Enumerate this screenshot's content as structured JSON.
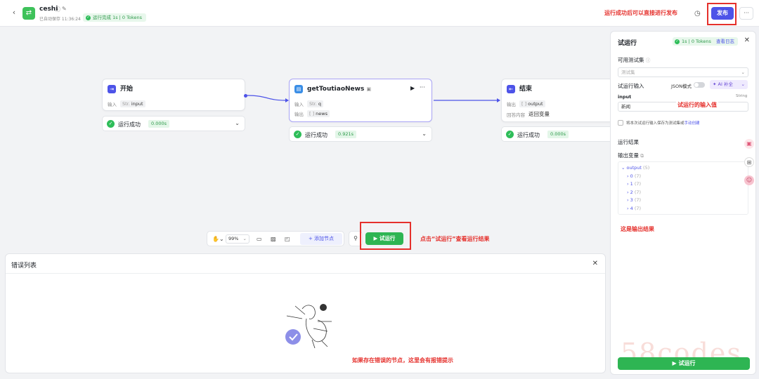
{
  "header": {
    "back": "‹",
    "app_icon": "workflow-icon",
    "app_name": "ceshi",
    "autosave": "已自动保存 11:36:24",
    "run_status": "运行完成 1s | 0 Tokens",
    "publish_note": "运行成功后可以直接进行发布",
    "publish_label": "发布",
    "more_label": "···"
  },
  "nodes": {
    "start": {
      "title": "开始",
      "input_label": "输入",
      "input_type": "Str.",
      "input_var": "input",
      "status": "运行成功",
      "time": "0.000s"
    },
    "plugin": {
      "title": "getToutiaoNews",
      "input_label": "输入",
      "input_type": "Str.",
      "input_var": "q",
      "output_label": "输出",
      "output_type": "[ ]",
      "output_var": "news",
      "status": "运行成功",
      "time": "0.921s"
    },
    "end": {
      "title": "结束",
      "output_label": "输出",
      "output_type": "[ ]",
      "output_var": "output",
      "answer_label": "回答内容",
      "answer_value": "返回变量",
      "status": "运行成功",
      "time": "0.000s"
    }
  },
  "toolbar": {
    "zoom": "99%",
    "add_node": "+ 添加节点",
    "trial_run": "▶ 试运行",
    "trial_note": "点击“试运行”查看运行结果"
  },
  "error_panel": {
    "title": "错误列表",
    "note": "如果存在错误的节点，这里会有报错提示"
  },
  "right_panel": {
    "title": "试运行",
    "badge": "1s | 0 Tokens",
    "badge_log": "查看日志",
    "testset_label": "可用测试集",
    "testset_placeholder": "测试集",
    "trial_input_label": "试运行输入",
    "json_mode": "JSON模式",
    "ai_fill": "✦ AI 补全",
    "input_name": "input",
    "input_type": "String",
    "input_value": "新闻",
    "input_note": "试运行的输入值",
    "save_checkbox": "将本次试运行输入保存为测试集或",
    "save_link": "手动创建",
    "result_label": "运行结果",
    "output_var_label": "输出变量",
    "tree_root": "output",
    "tree_root_count": "(5)",
    "tree_items": [
      {
        "k": "0",
        "c": "(7)"
      },
      {
        "k": "1",
        "c": "(7)"
      },
      {
        "k": "2",
        "c": "(7)"
      },
      {
        "k": "3",
        "c": "(7)"
      },
      {
        "k": "4",
        "c": "(7)"
      }
    ],
    "output_note": "这是输出结果",
    "run_button": "▶ 试运行"
  },
  "colors": {
    "accent": "#4d53e8",
    "success": "#2eb553",
    "annotation": "#e5302c"
  },
  "watermark": "58codes"
}
